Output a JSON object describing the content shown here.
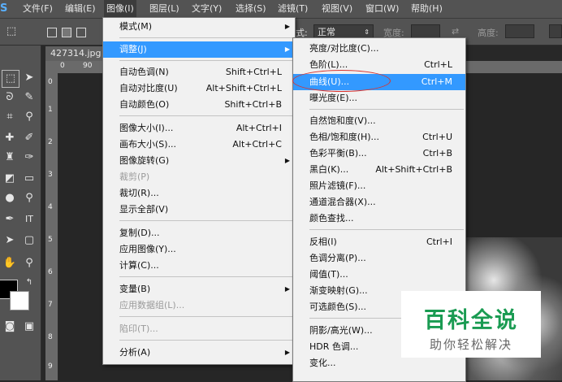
{
  "app_logo": "S",
  "menubar": {
    "items": [
      "文件(F)",
      "编辑(E)",
      "图像(I)",
      "图层(L)",
      "文字(Y)",
      "选择(S)",
      "滤镜(T)",
      "视图(V)",
      "窗口(W)",
      "帮助(H)"
    ]
  },
  "options_bar": {
    "style_label": "式:",
    "style_value": "正常",
    "width_label": "宽度:",
    "height_label": "高度:"
  },
  "document": {
    "tab_title": "427314.jpg",
    "h_ruler": [
      "0",
      "90"
    ],
    "v_ruler": [
      "0",
      "1",
      "2",
      "3",
      "4",
      "5",
      "6",
      "7",
      "8",
      "9"
    ]
  },
  "image_menu": {
    "items": [
      {
        "label": "模式(M)",
        "shortcut": "",
        "submenu": true,
        "disabled": false
      },
      {
        "label": "调整(J)",
        "shortcut": "",
        "submenu": true,
        "disabled": false,
        "highlighted": true
      },
      {
        "label": "自动色调(N)",
        "shortcut": "Shift+Ctrl+L",
        "disabled": false
      },
      {
        "label": "自动对比度(U)",
        "shortcut": "Alt+Shift+Ctrl+L",
        "disabled": false
      },
      {
        "label": "自动颜色(O)",
        "shortcut": "Shift+Ctrl+B",
        "disabled": false
      },
      {
        "label": "图像大小(I)...",
        "shortcut": "Alt+Ctrl+I",
        "disabled": false
      },
      {
        "label": "画布大小(S)...",
        "shortcut": "Alt+Ctrl+C",
        "disabled": false
      },
      {
        "label": "图像旋转(G)",
        "shortcut": "",
        "submenu": true,
        "disabled": false
      },
      {
        "label": "裁剪(P)",
        "shortcut": "",
        "disabled": true
      },
      {
        "label": "裁切(R)...",
        "shortcut": "",
        "disabled": false
      },
      {
        "label": "显示全部(V)",
        "shortcut": "",
        "disabled": false
      },
      {
        "label": "复制(D)...",
        "shortcut": "",
        "disabled": false
      },
      {
        "label": "应用图像(Y)...",
        "shortcut": "",
        "disabled": false
      },
      {
        "label": "计算(C)...",
        "shortcut": "",
        "disabled": false
      },
      {
        "label": "变量(B)",
        "shortcut": "",
        "submenu": true,
        "disabled": false
      },
      {
        "label": "应用数据组(L)...",
        "shortcut": "",
        "disabled": true
      },
      {
        "label": "陷印(T)...",
        "shortcut": "",
        "disabled": true
      },
      {
        "label": "分析(A)",
        "shortcut": "",
        "submenu": true,
        "disabled": false
      }
    ]
  },
  "adjust_submenu": {
    "items": [
      {
        "label": "亮度/对比度(C)...",
        "shortcut": ""
      },
      {
        "label": "色阶(L)...",
        "shortcut": "Ctrl+L"
      },
      {
        "label": "曲线(U)...",
        "shortcut": "Ctrl+M",
        "highlighted": true
      },
      {
        "label": "曝光度(E)...",
        "shortcut": ""
      },
      {
        "label": "自然饱和度(V)...",
        "shortcut": ""
      },
      {
        "label": "色相/饱和度(H)...",
        "shortcut": "Ctrl+U"
      },
      {
        "label": "色彩平衡(B)...",
        "shortcut": "Ctrl+B"
      },
      {
        "label": "黑白(K)...",
        "shortcut": "Alt+Shift+Ctrl+B"
      },
      {
        "label": "照片滤镜(F)...",
        "shortcut": ""
      },
      {
        "label": "通道混合器(X)...",
        "shortcut": ""
      },
      {
        "label": "颜色查找...",
        "shortcut": ""
      },
      {
        "label": "反相(I)",
        "shortcut": "Ctrl+I"
      },
      {
        "label": "色调分离(P)...",
        "shortcut": ""
      },
      {
        "label": "阈值(T)...",
        "shortcut": ""
      },
      {
        "label": "渐变映射(G)...",
        "shortcut": ""
      },
      {
        "label": "可选颜色(S)...",
        "shortcut": ""
      },
      {
        "label": "阴影/高光(W)...",
        "shortcut": ""
      },
      {
        "label": "HDR 色调...",
        "shortcut": ""
      },
      {
        "label": "变化...",
        "shortcut": ""
      }
    ]
  },
  "watermark": {
    "title": "百科全说",
    "subtitle": "助你轻松解决"
  },
  "colors": {
    "highlight": "#3399ff",
    "annotation_circle": "#d9332e",
    "watermark_green": "#1a9b52"
  }
}
